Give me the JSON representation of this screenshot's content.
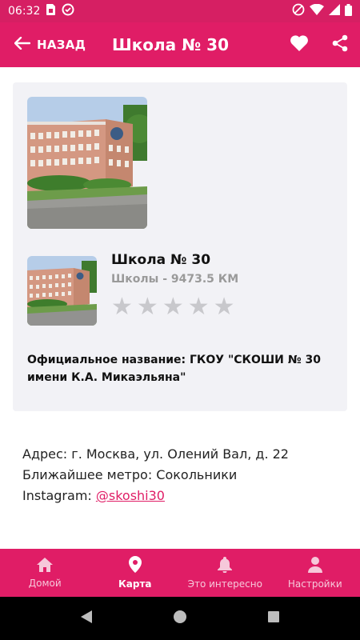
{
  "status_bar": {
    "time": "06:32"
  },
  "app_bar": {
    "back_label": "НАЗАД",
    "title": "Школа № 30"
  },
  "place": {
    "name": "Школа № 30",
    "subtitle": "Школы - 9473.5 КМ",
    "rating": 0,
    "rating_max": 5,
    "official_name": "Официальное название: ГКОУ \"СКОШИ № 30 имени К.А. Микаэльяна\""
  },
  "details": {
    "address": "Адрес: г. Москва, ул. Олений Вал, д. 22",
    "metro": "Ближайшее метро: Сокольники",
    "instagram_label": "Instagram: ",
    "instagram_handle": "@skoshi30"
  },
  "bottom_nav": {
    "items": [
      {
        "label": "Домой",
        "icon": "home-icon",
        "active": false
      },
      {
        "label": "Карта",
        "icon": "map-pin-icon",
        "active": true
      },
      {
        "label": "Это интересно",
        "icon": "bell-icon",
        "active": false
      },
      {
        "label": "Настройки",
        "icon": "person-icon",
        "active": false
      }
    ]
  },
  "colors": {
    "accent": "#e01d66",
    "status_bar": "#d61f63",
    "card_bg": "#f2f2f6",
    "star_inactive": "#c8c8cc"
  }
}
